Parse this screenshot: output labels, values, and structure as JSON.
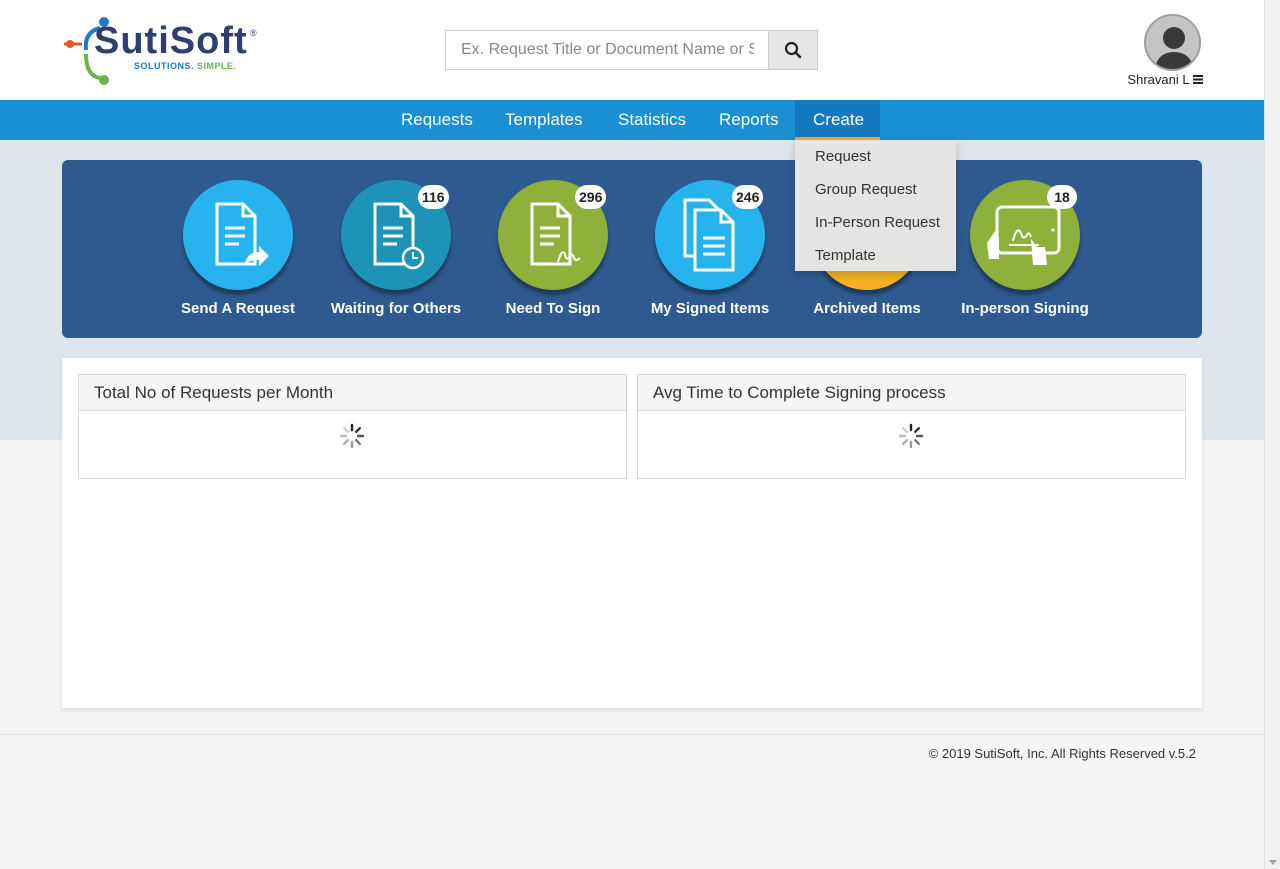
{
  "logo": {
    "name": "SutiSoft",
    "registered": "®",
    "tagline_part1": "SOLUTIONS.",
    "tagline_part2": "SIMPLE."
  },
  "search": {
    "placeholder": "Ex. Request Title or Document Name or S",
    "icon": "search-icon"
  },
  "user": {
    "name": "Shravani L",
    "menu_icon": "hamburger-icon"
  },
  "nav": {
    "items": [
      {
        "label": "Requests",
        "active": false
      },
      {
        "label": "Templates",
        "active": false
      },
      {
        "label": "Statistics",
        "active": false
      },
      {
        "label": "Reports",
        "active": false
      },
      {
        "label": "Create",
        "active": true
      }
    ]
  },
  "create_menu": {
    "items": [
      {
        "label": "Request"
      },
      {
        "label": "Group Request"
      },
      {
        "label": "In-Person Request"
      },
      {
        "label": "Template"
      }
    ]
  },
  "tiles": [
    {
      "label": "Send A Request",
      "badge": "",
      "color": "#26b3ee",
      "icon": "document-send-icon"
    },
    {
      "label": "Waiting for Others",
      "badge": "116",
      "color": "#1c93b7",
      "icon": "document-clock-icon"
    },
    {
      "label": "Need To Sign",
      "badge": "296",
      "color": "#8db13a",
      "icon": "document-sign-icon"
    },
    {
      "label": "My Signed Items",
      "badge": "246",
      "color": "#26b3ee",
      "icon": "documents-stack-icon"
    },
    {
      "label": "Archived Items",
      "badge": "",
      "color": "#f5b324",
      "icon": "archive-icon"
    },
    {
      "label": "In-person Signing",
      "badge": "18",
      "color": "#8db13a",
      "icon": "tablet-sign-icon"
    }
  ],
  "panels": [
    {
      "title": "Total No of Requests per Month",
      "loading": true
    },
    {
      "title": "Avg Time to Complete Signing process",
      "loading": true
    }
  ],
  "footer": {
    "text": "© 2019 SutiSoft, Inc. All Rights Reserved v.5.2"
  }
}
